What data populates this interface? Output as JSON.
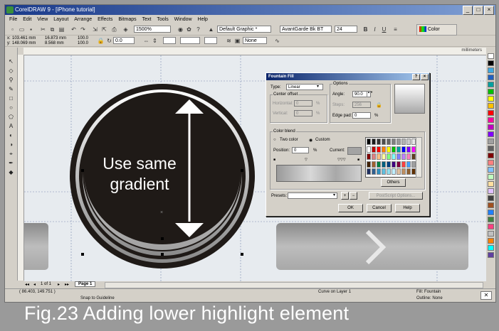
{
  "app": {
    "title": "CorelDRAW 9 - [iPhone tutorial]",
    "menu": [
      "File",
      "Edit",
      "View",
      "Layout",
      "Arrange",
      "Effects",
      "Bitmaps",
      "Text",
      "Tools",
      "Window",
      "Help"
    ]
  },
  "toolbar": {
    "zoom": "1500%",
    "style": "Default Graphic *",
    "font": "AvantGarde Bk BT",
    "font_size": "24",
    "bold": "B",
    "italic": "I",
    "underline": "U",
    "color_label": "Color"
  },
  "property_bar": {
    "x": "103.461 mm",
    "y": "148.069 mm",
    "w": "16.873 mm",
    "h": "8.568 mm",
    "scale_x": "100.0",
    "scale_y": "100.0",
    "angle": "0.0",
    "outline": "None"
  },
  "ruler": {
    "unit": "millimeters"
  },
  "canvas": {
    "button_text_line1": "Use same",
    "button_text_line2": "gradient",
    "arrow_glyph": "›"
  },
  "dialog": {
    "title": "Fountain Fill",
    "help_btn": "?",
    "close_btn": "×",
    "type_label": "Type:",
    "type_value": "Linear",
    "center_offset_label": "Center offset",
    "horizontal_label": "Horizontal:",
    "horizontal_value": "0",
    "vertical_label": "Vertical:",
    "vertical_value": "0",
    "percent": "%",
    "options_label": "Options",
    "angle_label": "Angle:",
    "angle_value": "90.0",
    "steps_label": "Steps:",
    "steps_value": "256",
    "edge_pad_label": "Edge pad:",
    "edge_pad_value": "0",
    "color_blend_label": "Color blend",
    "two_color_label": "Two color",
    "custom_label": "Custom",
    "position_label": "Position:",
    "position_value": "0",
    "current_label": "Current:",
    "others_label": "Others",
    "presets_label": "Presets:",
    "add_preset": "+",
    "remove_preset": "−",
    "postscript_label": "PostScript Options...",
    "ok_label": "OK",
    "cancel_label": "Cancel",
    "help_label": "Help",
    "colors": [
      "#000000",
      "#1a1a1a",
      "#333333",
      "#4d4d4d",
      "#666666",
      "#808080",
      "#999999",
      "#b3b3b3",
      "#cccccc",
      "#e6e6e6",
      "#ffffff",
      "#c00000",
      "#ff0000",
      "#ff8000",
      "#ffff00",
      "#00c000",
      "#00a0a0",
      "#0000ff",
      "#8000ff",
      "#ff00ff",
      "#800000",
      "#e08080",
      "#ffc080",
      "#ffffa0",
      "#80ff80",
      "#80ffff",
      "#8080ff",
      "#c080ff",
      "#ff80c0",
      "#604020",
      "#402000",
      "#a06030",
      "#008040",
      "#006080",
      "#004080",
      "#400080",
      "#800040",
      "#ff4040",
      "#40a0ff",
      "#a0a0a0",
      "#203060",
      "#306090",
      "#3090c0",
      "#60c0e0",
      "#90e0f0",
      "#c0f0ff",
      "#e0c0a0",
      "#c09060",
      "#906030",
      "#603000"
    ]
  },
  "pages": {
    "count_text": "1 of 1",
    "tab_label": "Page 1"
  },
  "status": {
    "coords": "( 86.403, 149.751 )",
    "snap": "Snap to Guideline",
    "object": "Curve on Layer 1",
    "fill": "Fill: Fountain",
    "outline": "Outline: None"
  },
  "palette_colors": [
    "#ffffff",
    "#000000",
    "#3ea8e0",
    "#2060c0",
    "#00a0a0",
    "#00c000",
    "#ffff00",
    "#ffc000",
    "#ff0000",
    "#ff00a0",
    "#c000c0",
    "#8000ff",
    "#a0a0a0",
    "#606060",
    "#800000",
    "#ff8080",
    "#80c0ff",
    "#c0ffc0",
    "#ffe0a0",
    "#e0c0ff",
    "#404040",
    "#a05020",
    "#2080ff",
    "#408040",
    "#ff4080",
    "#c0c0c0",
    "#ff8000",
    "#00ffff",
    "#6040a0"
  ],
  "caption": "Fig.23  Adding lower highlight element"
}
